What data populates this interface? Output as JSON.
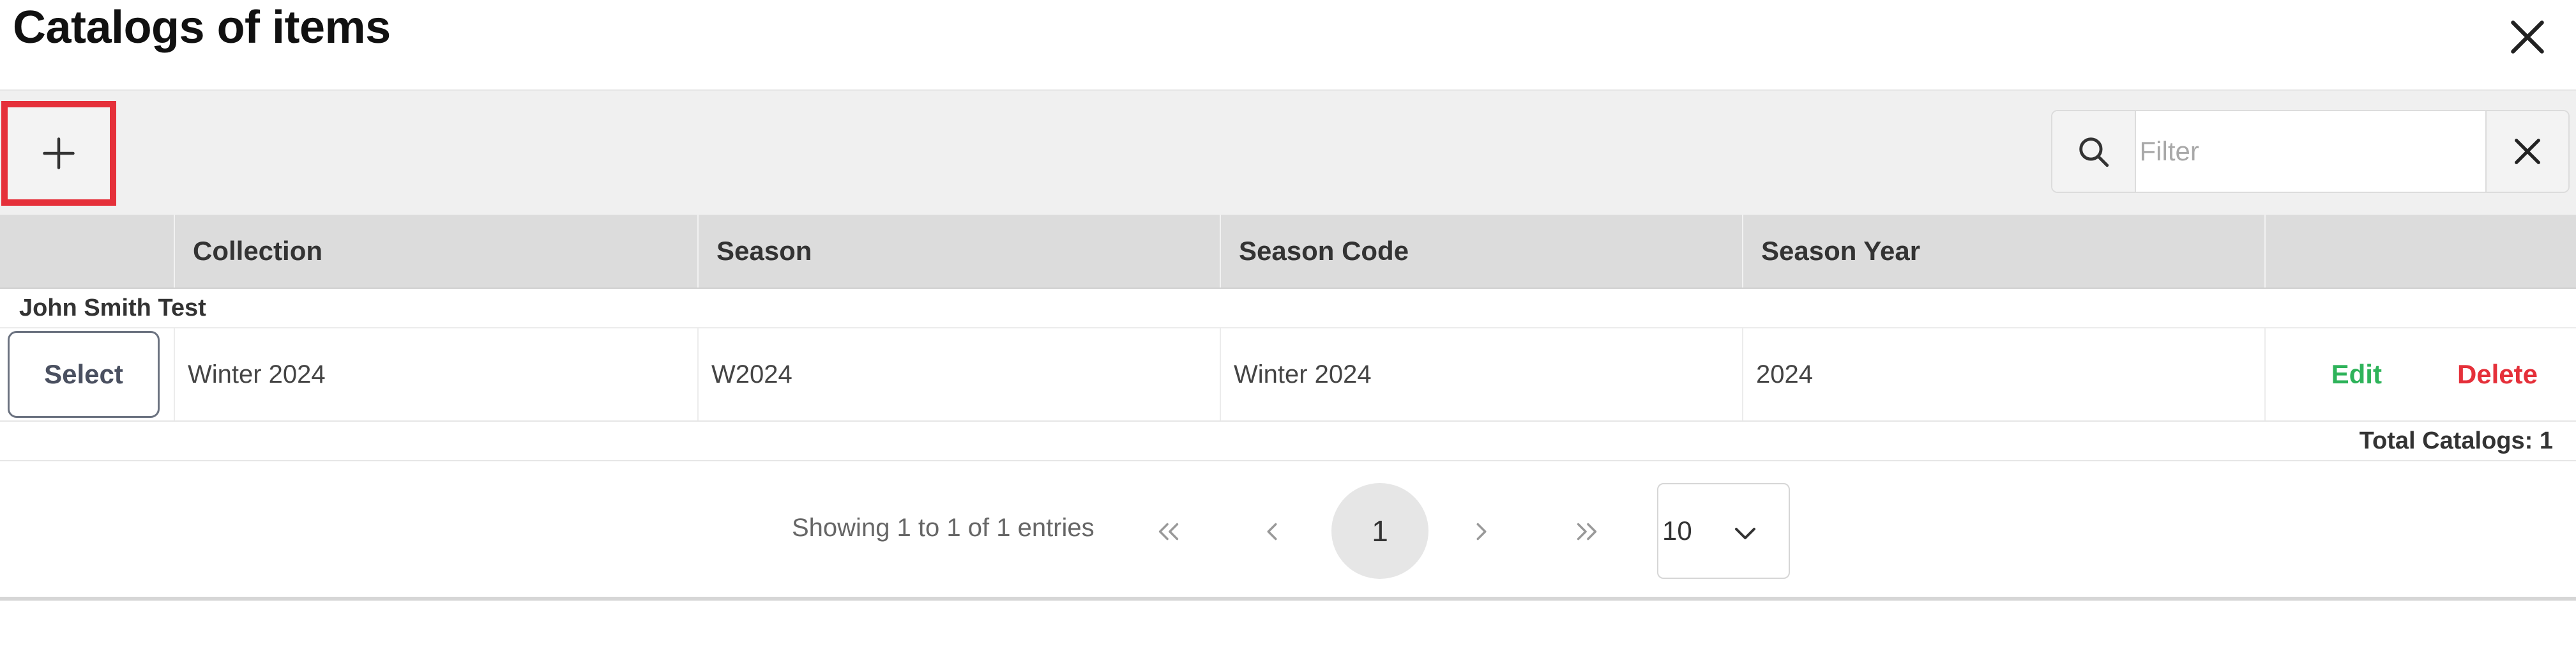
{
  "dialog": {
    "title": "Catalogs of items",
    "close_icon": "close-icon"
  },
  "toolbar": {
    "add_icon": "plus-icon",
    "add_button_highlight_color": "#e5303a",
    "filter": {
      "placeholder": "Filter",
      "value": "",
      "search_icon": "search-icon",
      "clear_icon": "close-icon"
    }
  },
  "table": {
    "columns": [
      "",
      "Collection",
      "Season",
      "Season Code",
      "Season Year",
      ""
    ],
    "groups": [
      {
        "name": "John Smith Test",
        "rows": [
          {
            "select_label": "Select",
            "collection": "Winter 2024",
            "season": "W2024",
            "season_code": "Winter 2024",
            "season_year": "2024",
            "edit_label": "Edit",
            "delete_label": "Delete"
          }
        ]
      }
    ],
    "total_label": "Total Catalogs: 1",
    "colors": {
      "edit": "#2eb35a",
      "delete": "#e5303a",
      "header_bg": "#dcdcdc"
    }
  },
  "pagination": {
    "info": "Showing 1 to 1 of 1 entries",
    "first_icon": "chevrons-left-icon",
    "prev_icon": "chevron-left-icon",
    "current_page": "1",
    "next_icon": "chevron-right-icon",
    "last_icon": "chevrons-right-icon",
    "page_size": "10",
    "page_size_icon": "chevron-down-icon"
  }
}
